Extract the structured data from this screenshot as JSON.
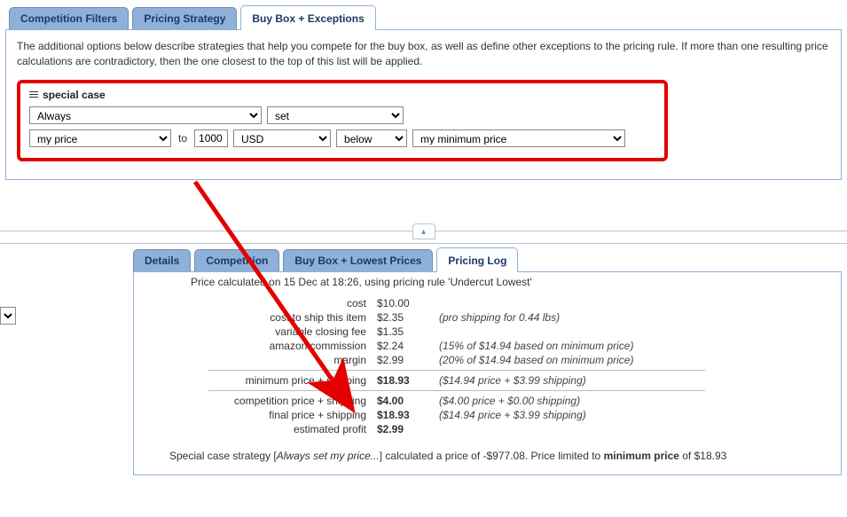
{
  "upper_tabs": {
    "competition_filters": "Competition Filters",
    "pricing_strategy": "Pricing Strategy",
    "buy_box_exceptions": "Buy Box + Exceptions"
  },
  "intro_text": "The additional options below describe strategies that help you compete for the buy box, as well as define other exceptions to the pricing rule. If more than one resulting price calculations are contradictory, then the one closest to the top of this list will be applied.",
  "special_case": {
    "legend": "special case",
    "select_when": "Always",
    "select_action": "set",
    "select_target": "my price",
    "to_label": "to",
    "number_value": "1000",
    "currency": "USD",
    "relation": "below",
    "reference": "my minimum price"
  },
  "lower_tabs": {
    "details": "Details",
    "competition": "Competition",
    "buy_box_lowest": "Buy Box + Lowest Prices",
    "pricing_log": "Pricing Log"
  },
  "pricing_log": {
    "header": "Price calculated on 15 Dec at 18:26, using pricing rule 'Undercut Lowest'",
    "rows": {
      "cost": {
        "label": "cost",
        "value": "$10.00",
        "note": ""
      },
      "cost_ship": {
        "label": "cost to ship this item",
        "value": "$2.35",
        "note": "(pro shipping for 0.44 lbs)"
      },
      "vcf": {
        "label": "variable closing fee",
        "value": "$1.35",
        "note": ""
      },
      "commission": {
        "label": "amazon commission",
        "value": "$2.24",
        "note": "(15% of $14.94 based on minimum price)"
      },
      "margin": {
        "label": "margin",
        "value": "$2.99",
        "note": "(20% of $14.94 based on minimum price)"
      },
      "min_ship": {
        "label": "minimum price + shipping",
        "value": "$18.93",
        "note": "($14.94 price + $3.99 shipping)"
      },
      "comp_ship": {
        "label": "competition price + shipping",
        "value": "$4.00",
        "note": "($4.00 price + $0.00 shipping)"
      },
      "final_ship": {
        "label": "final price + shipping",
        "value": "$18.93",
        "note": "($14.94 price + $3.99 shipping)"
      },
      "profit": {
        "label": "estimated profit",
        "value": "$2.99",
        "note": ""
      }
    },
    "footnote_pre": "Special case strategy [",
    "footnote_em": "Always set my price...",
    "footnote_mid": "] calculated a price of -$977.08. Price limited to ",
    "footnote_bold": "minimum price",
    "footnote_post": " of $18.93"
  }
}
